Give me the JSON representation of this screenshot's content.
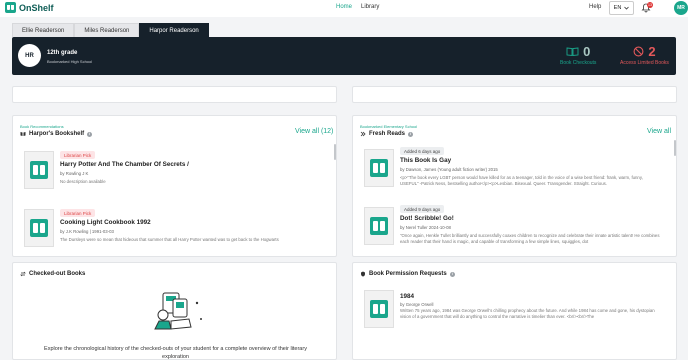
{
  "nav": {
    "brand": "OnShelf",
    "links": [
      "Home",
      "Library"
    ],
    "help": "Help",
    "language": "EN",
    "notifications_count": "13",
    "user_initials": "MR"
  },
  "tabs": [
    "Ellie Readerson",
    "Miles Readerson",
    "Harpor Readerson"
  ],
  "student": {
    "initials": "HR",
    "grade": "12th grade",
    "school": "Bookmarked High School",
    "checkouts_count": "0",
    "checkouts_label": "Book Checkouts",
    "limited_count": "2",
    "limited_label": "Access Limited Books"
  },
  "recommendations": {
    "kicker": "Book Recommendations",
    "title": "Harpor's Bookshelf",
    "view_all": "View all (12)",
    "books": [
      {
        "pill": "Librarian Pick",
        "title": "Harry Potter And The Chamber Of Secrets /",
        "by": "by Rowling J K",
        "desc": "No description available"
      },
      {
        "pill": "Librarian Pick",
        "title": "Cooking Light Cookbook 1992",
        "by": "by J.K Rowling | 1991-03-03",
        "desc": "The Dursleys were so mean that hideous that summer that all Harry Potter wanted was to get back to the Hogwarts"
      }
    ]
  },
  "fresh": {
    "kicker": "Bookmarked Elementary School",
    "title": "Fresh Reads",
    "view_all": "View all",
    "books": [
      {
        "pill": "Added 6 days ago",
        "title": "This Book Is Gay",
        "by": "by Dawson, James (Young adult fiction writer) 2015",
        "desc": "<p>\"The book every LGBT person would have killed for as a teenager, told in the voice of a wise best friend: frank, warm, funny, USEFUL\" -Patrick Ness, bestselling author</p><p>Lesbian. Bisexual. Queer. Transgender. Straight. Curious."
      },
      {
        "pill": "Added 9 days ago",
        "title": "Dot! Scribble! Go!",
        "by": "by Nerel Tuller 2024-10-08",
        "desc": "\"Once again, Henkle Tullet brilliantly and successfully coaxes children to recognize and celebrate their innate artistic talent! He combines each reader that their hand is magic, and capable of transforming a few simple lines, squiggles, dot"
      }
    ]
  },
  "checked_out": {
    "title": "Checked-out Books",
    "empty_text": "Explore the chronological history of the checked-outs of your student for a complete overview of their literary exploration"
  },
  "permission": {
    "title": "Book Permission Requests",
    "book": {
      "title": "1984",
      "by": "by George Orwell",
      "desc": "Written 75 years ago, 1984 was George Orwell's chilling prophecy about the future. And while 1984 has come and gone, his dystopian vision of a government that will do anything to control the narrative is timelier than ever. <br/><br/>The"
    }
  },
  "colors": {
    "accent": "#1aa68c",
    "dark": "#16212b",
    "danger": "#e2585a"
  }
}
